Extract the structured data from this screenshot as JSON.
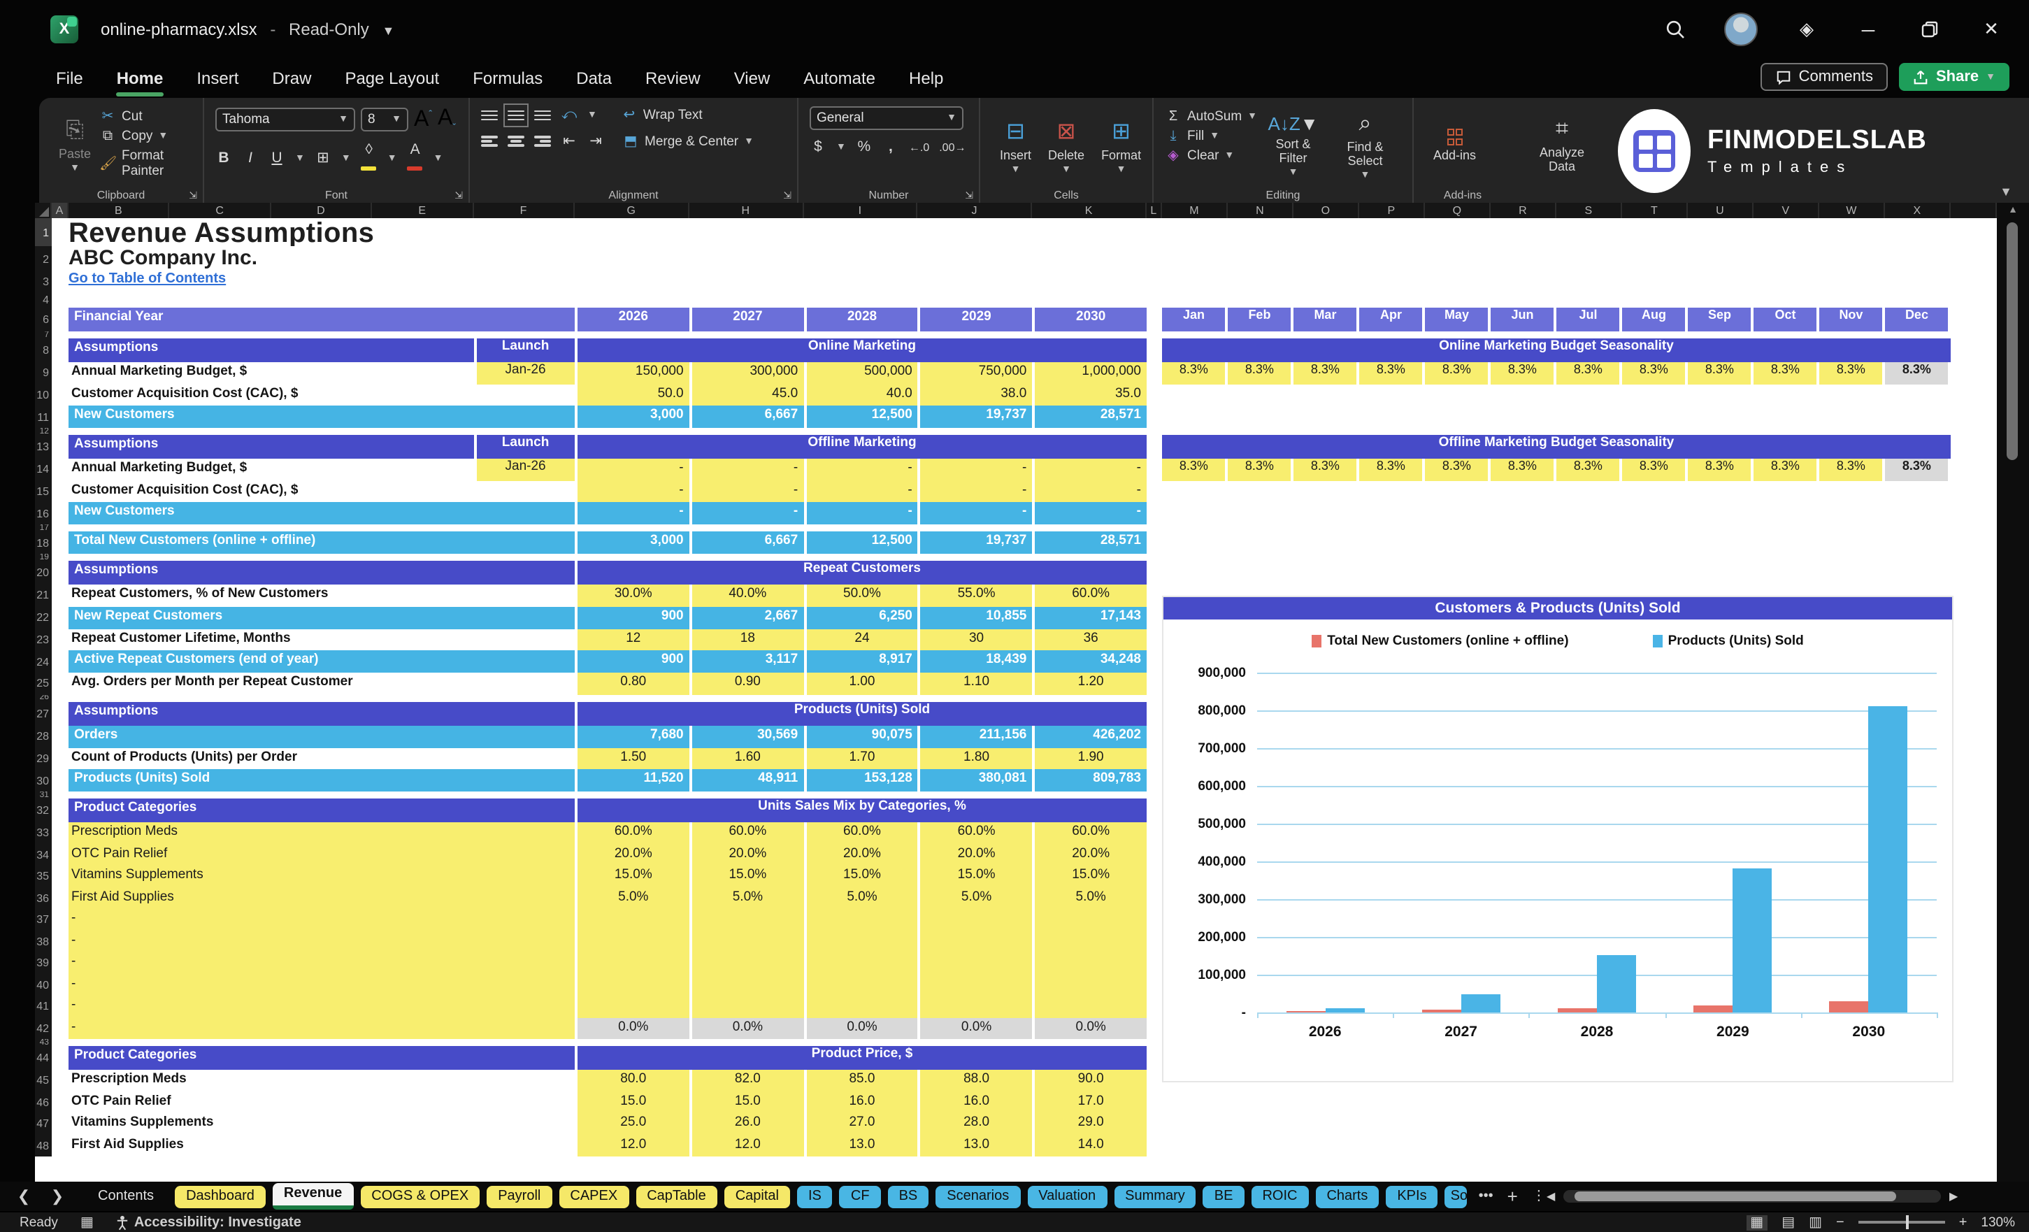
{
  "window": {
    "doc_name": "online-pharmacy.xlsx",
    "separator": "-",
    "mode": "Read-Only"
  },
  "menu": {
    "items": [
      "File",
      "Home",
      "Insert",
      "Draw",
      "Page Layout",
      "Formulas",
      "Data",
      "Review",
      "View",
      "Automate",
      "Help"
    ],
    "active": "Home"
  },
  "top_actions": {
    "comments": "Comments",
    "share": "Share"
  },
  "ribbon": {
    "clipboard": {
      "label": "Clipboard",
      "paste": "Paste",
      "cut": "Cut",
      "copy": "Copy",
      "format_painter": "Format Painter"
    },
    "font": {
      "label": "Font",
      "font_name": "Tahoma",
      "font_size": "8",
      "bold": "B",
      "italic": "I",
      "underline": "U"
    },
    "alignment": {
      "label": "Alignment",
      "wrap_text": "Wrap Text",
      "merge_center": "Merge & Center"
    },
    "number": {
      "label": "Number",
      "format": "General",
      "currency": "$",
      "percent": "%",
      "comma": ","
    },
    "cells": {
      "label": "Cells",
      "insert": "Insert",
      "delete": "Delete",
      "format": "Format"
    },
    "editing": {
      "label": "Editing",
      "autosum": "AutoSum",
      "fill": "Fill",
      "clear": "Clear",
      "sort_filter": "Sort & Filter",
      "find_select": "Find & Select"
    },
    "addins": {
      "label": "Add-ins",
      "addins": "Add-ins",
      "analyze": "Analyze Data"
    }
  },
  "brand": {
    "name": "FINMODELSLAB",
    "sub": "Templates"
  },
  "colors": {
    "accent_purple": "#474bc8",
    "band_purple": "#6b6fd9",
    "cyan": "#45b4e4",
    "input_yellow": "#f8ee6f",
    "grey_cell": "#d9d9d9",
    "excel_green": "#1e9e5a",
    "chart_red": "#e8746a",
    "chart_blue": "#4ab4e6",
    "link_blue": "#2f6fd6"
  },
  "sheet": {
    "columns_left": [
      "A",
      "B",
      "C",
      "D",
      "E",
      "F",
      "G",
      "H",
      "I",
      "J",
      "K",
      "L"
    ],
    "columns_right": [
      "M",
      "N",
      "O",
      "P",
      "Q",
      "R",
      "S",
      "T",
      "U",
      "V",
      "W",
      "X"
    ],
    "months": [
      "Jan",
      "Feb",
      "Mar",
      "Apr",
      "May",
      "Jun",
      "Jul",
      "Aug",
      "Sep",
      "Oct",
      "Nov",
      "Dec"
    ],
    "years": [
      "2026",
      "2027",
      "2028",
      "2029",
      "2030"
    ]
  },
  "rows": [
    {
      "n": "1",
      "t": "title",
      "label": "Revenue Assumptions"
    },
    {
      "n": "2",
      "t": "company",
      "label": "ABC Company Inc."
    },
    {
      "n": "3",
      "t": "link",
      "label": "Go to Table of Contents"
    },
    {
      "n": "4",
      "t": "blank",
      "label": ""
    },
    {
      "n": "6",
      "t": "yearband",
      "label": "Financial Year",
      "right": "months"
    },
    {
      "n": "7",
      "t": "spacer"
    },
    {
      "n": "8",
      "t": "band3",
      "label": "Assumptions",
      "launch": "Launch",
      "mid": "Online Marketing",
      "right": "rband",
      "rtitle": "Online Marketing Budget Seasonality"
    },
    {
      "n": "9",
      "t": "data",
      "label": "Annual Marketing Budget, $",
      "launch": "Jan-26",
      "v": [
        "150,000",
        "300,000",
        "500,000",
        "750,000",
        "1,000,000"
      ],
      "align": "ar",
      "right": "rseason"
    },
    {
      "n": "10",
      "t": "data",
      "label": "Customer Acquisition Cost (CAC), $",
      "v": [
        "50.0",
        "45.0",
        "40.0",
        "38.0",
        "35.0"
      ],
      "align": "ar"
    },
    {
      "n": "11",
      "t": "cyan",
      "label": "New Customers",
      "v": [
        "3,000",
        "6,667",
        "12,500",
        "19,737",
        "28,571"
      ]
    },
    {
      "n": "12",
      "t": "spacer"
    },
    {
      "n": "13",
      "t": "band3",
      "label": "Assumptions",
      "launch": "Launch",
      "mid": "Offline Marketing",
      "right": "rband",
      "rtitle": "Offline Marketing Budget Seasonality"
    },
    {
      "n": "14",
      "t": "data",
      "label": "Annual Marketing Budget, $",
      "launch": "Jan-26",
      "v": [
        "-",
        "-",
        "-",
        "-",
        "-"
      ],
      "align": "ar",
      "right": "rseason"
    },
    {
      "n": "15",
      "t": "data",
      "label": "Customer Acquisition Cost (CAC), $",
      "v": [
        "-",
        "-",
        "-",
        "-",
        "-"
      ],
      "align": "ar"
    },
    {
      "n": "16",
      "t": "cyan",
      "label": "New Customers",
      "v": [
        "-",
        "-",
        "-",
        "-",
        "-"
      ]
    },
    {
      "n": "17",
      "t": "spacer"
    },
    {
      "n": "18",
      "t": "cyan",
      "label": "Total New Customers (online + offline)",
      "v": [
        "3,000",
        "6,667",
        "12,500",
        "19,737",
        "28,571"
      ]
    },
    {
      "n": "19",
      "t": "spacer"
    },
    {
      "n": "20",
      "t": "band2",
      "label": "Assumptions",
      "mid": "Repeat Customers"
    },
    {
      "n": "21",
      "t": "data",
      "label": "Repeat Customers, % of New Customers",
      "v": [
        "30.0%",
        "40.0%",
        "50.0%",
        "55.0%",
        "60.0%"
      ],
      "align": "ac"
    },
    {
      "n": "22",
      "t": "cyan",
      "label": "New Repeat Customers",
      "v": [
        "900",
        "2,667",
        "6,250",
        "10,855",
        "17,143"
      ]
    },
    {
      "n": "23",
      "t": "data",
      "label": "Repeat Customer Lifetime, Months",
      "v": [
        "12",
        "18",
        "24",
        "30",
        "36"
      ],
      "align": "ac"
    },
    {
      "n": "24",
      "t": "cyan",
      "label": "Active Repeat Customers (end of year)",
      "v": [
        "900",
        "3,117",
        "8,917",
        "18,439",
        "34,248"
      ]
    },
    {
      "n": "25",
      "t": "data",
      "label": "Avg. Orders per Month per Repeat Customer",
      "v": [
        "0.80",
        "0.90",
        "1.00",
        "1.10",
        "1.20"
      ],
      "align": "ac"
    },
    {
      "n": "26",
      "t": "spacer"
    },
    {
      "n": "27",
      "t": "band2",
      "label": "Assumptions",
      "mid": "Products (Units) Sold"
    },
    {
      "n": "28",
      "t": "cyan",
      "label": "Orders",
      "v": [
        "7,680",
        "30,569",
        "90,075",
        "211,156",
        "426,202"
      ]
    },
    {
      "n": "29",
      "t": "data",
      "label": "Count of Products (Units) per Order",
      "v": [
        "1.50",
        "1.60",
        "1.70",
        "1.80",
        "1.90"
      ],
      "align": "ac"
    },
    {
      "n": "30",
      "t": "cyan",
      "label": "Products (Units) Sold",
      "v": [
        "11,520",
        "48,911",
        "153,128",
        "380,081",
        "809,783"
      ]
    },
    {
      "n": "31",
      "t": "spacer"
    },
    {
      "n": "32",
      "t": "band2",
      "label": "Product Categories",
      "mid": "Units Sales Mix by Categories, %"
    },
    {
      "n": "33",
      "t": "cat",
      "label": "Prescription Meds",
      "v": [
        "60.0%",
        "60.0%",
        "60.0%",
        "60.0%",
        "60.0%"
      ]
    },
    {
      "n": "34",
      "t": "cat",
      "label": "OTC Pain Relief",
      "v": [
        "20.0%",
        "20.0%",
        "20.0%",
        "20.0%",
        "20.0%"
      ]
    },
    {
      "n": "35",
      "t": "cat",
      "label": "Vitamins Supplements",
      "v": [
        "15.0%",
        "15.0%",
        "15.0%",
        "15.0%",
        "15.0%"
      ]
    },
    {
      "n": "36",
      "t": "cat",
      "label": "First Aid Supplies",
      "v": [
        "5.0%",
        "5.0%",
        "5.0%",
        "5.0%",
        "5.0%"
      ]
    },
    {
      "n": "37",
      "t": "cat",
      "label": "-",
      "v": [
        "",
        "",
        "",
        "",
        ""
      ]
    },
    {
      "n": "38",
      "t": "cat",
      "label": "-",
      "v": [
        "",
        "",
        "",
        "",
        ""
      ]
    },
    {
      "n": "39",
      "t": "cat",
      "label": "-",
      "v": [
        "",
        "",
        "",
        "",
        ""
      ]
    },
    {
      "n": "40",
      "t": "cat",
      "label": "-",
      "v": [
        "",
        "",
        "",
        "",
        ""
      ]
    },
    {
      "n": "41",
      "t": "cat",
      "label": "-",
      "v": [
        "",
        "",
        "",
        "",
        ""
      ]
    },
    {
      "n": "42",
      "t": "catgrey",
      "label": "-",
      "v": [
        "0.0%",
        "0.0%",
        "0.0%",
        "0.0%",
        "0.0%"
      ]
    },
    {
      "n": "43",
      "t": "spacer"
    },
    {
      "n": "44",
      "t": "band2",
      "label": "Product Categories",
      "mid": "Product Price, $"
    },
    {
      "n": "45",
      "t": "price",
      "label": "Prescription Meds",
      "v": [
        "80.0",
        "82.0",
        "85.0",
        "88.0",
        "90.0"
      ]
    },
    {
      "n": "46",
      "t": "price",
      "label": "OTC Pain Relief",
      "v": [
        "15.0",
        "15.0",
        "16.0",
        "16.0",
        "17.0"
      ]
    },
    {
      "n": "47",
      "t": "price",
      "label": "Vitamins Supplements",
      "v": [
        "25.0",
        "26.0",
        "27.0",
        "28.0",
        "29.0"
      ]
    },
    {
      "n": "48",
      "t": "price",
      "label": "First Aid Supplies",
      "v": [
        "12.0",
        "12.0",
        "13.0",
        "13.0",
        "14.0"
      ]
    }
  ],
  "seasonality": {
    "values": [
      "8.3%",
      "8.3%",
      "8.3%",
      "8.3%",
      "8.3%",
      "8.3%",
      "8.3%",
      "8.3%",
      "8.3%",
      "8.3%",
      "8.3%",
      "8.3%"
    ]
  },
  "chart_data": {
    "type": "bar",
    "title": "Customers & Products (Units) Sold",
    "categories": [
      "2026",
      "2027",
      "2028",
      "2029",
      "2030"
    ],
    "series": [
      {
        "name": "Total New Customers (online + offline)",
        "color": "#e8746a",
        "values": [
          3000,
          6667,
          12500,
          19737,
          28571
        ]
      },
      {
        "name": "Products (Units) Sold",
        "color": "#4ab4e6",
        "values": [
          11520,
          48911,
          153128,
          380081,
          809783
        ]
      }
    ],
    "ylim": [
      0,
      900000
    ],
    "ytick_step": 100000,
    "ytick_labels": [
      "900,000",
      "800,000",
      "700,000",
      "600,000",
      "500,000",
      "400,000",
      "300,000",
      "200,000",
      "100,000",
      "-"
    ],
    "grid": true,
    "legend_position": "top"
  },
  "tabs": {
    "items": [
      {
        "label": "Contents",
        "style": "plain"
      },
      {
        "label": "Dashboard",
        "style": "yellow"
      },
      {
        "label": "Revenue",
        "style": "active"
      },
      {
        "label": "COGS & OPEX",
        "style": "yellow"
      },
      {
        "label": "Payroll",
        "style": "yellow"
      },
      {
        "label": "CAPEX",
        "style": "yellow"
      },
      {
        "label": "CapTable",
        "style": "yellow"
      },
      {
        "label": "Capital",
        "style": "yellow"
      },
      {
        "label": "IS",
        "style": "blue"
      },
      {
        "label": "CF",
        "style": "blue"
      },
      {
        "label": "BS",
        "style": "blue"
      },
      {
        "label": "Scenarios",
        "style": "blue"
      },
      {
        "label": "Valuation",
        "style": "blue"
      },
      {
        "label": "Summary",
        "style": "blue"
      },
      {
        "label": "BE",
        "style": "blue"
      },
      {
        "label": "ROIC",
        "style": "blue"
      },
      {
        "label": "Charts",
        "style": "blue"
      },
      {
        "label": "KPIs",
        "style": "blue"
      },
      {
        "label": "So",
        "style": "blue-cut"
      }
    ]
  },
  "status": {
    "ready": "Ready",
    "accessibility": "Accessibility: Investigate",
    "zoom_level": "130%"
  }
}
